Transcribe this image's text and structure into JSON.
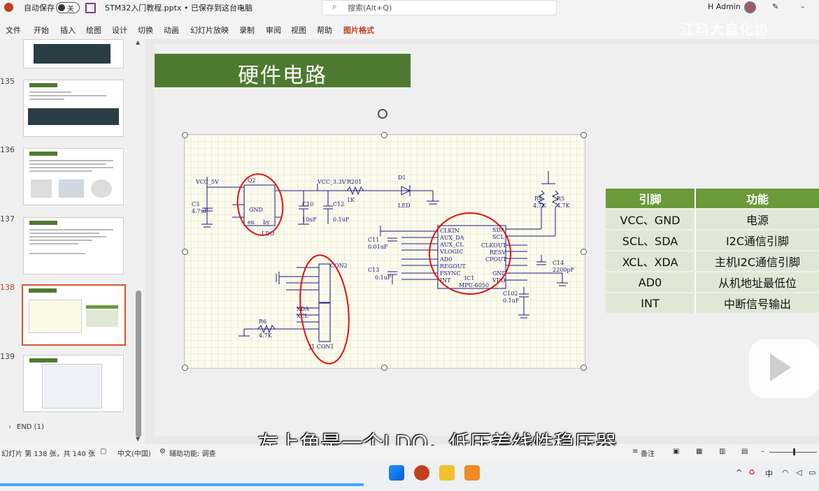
{
  "titlebar": {
    "autosave_label": "自动保存",
    "autosave_state": "关",
    "file_title": "STM32入门教程.pptx • 已保存到这台电脑",
    "search_placeholder": "搜索(Alt+Q)",
    "user": "H Admin",
    "minimize": "–"
  },
  "ribbon": {
    "tabs": [
      "文件",
      "开始",
      "插入",
      "绘图",
      "设计",
      "切换",
      "动画",
      "幻灯片放映",
      "录制",
      "审阅",
      "视图",
      "帮助",
      "图片格式"
    ],
    "active_tab": "图片格式"
  },
  "watermark": "江科大自化协",
  "thumbnails": [
    {
      "num": "135",
      "title": "I2C时序"
    },
    {
      "num": "136",
      "title": "MPU6050简介"
    },
    {
      "num": "137",
      "title": "MPU6050参数"
    },
    {
      "num": "138",
      "title": "硬件电路",
      "selected": true
    },
    {
      "num": "139",
      "title": "MPU6050框图"
    }
  ],
  "section_end": "END (1)",
  "slide": {
    "title": "硬件电路",
    "table": {
      "headers": [
        "引脚",
        "功能"
      ],
      "rows": [
        [
          "VCC、GND",
          "电源"
        ],
        [
          "SCL、SDA",
          "I2C通信引脚"
        ],
        [
          "XCL、XDA",
          "主机I2C通信引脚"
        ],
        [
          "AD0",
          "从机地址最低位"
        ],
        [
          "INT",
          "中断信号输出"
        ]
      ]
    },
    "schematic": {
      "labels": [
        "VCC_5V",
        "Q2",
        "GND",
        "en",
        "by",
        "LDO",
        "C3",
        "4.7uF",
        "VCC_3.3V",
        "C10",
        "10uF",
        "C12",
        "0.1uF",
        "R201",
        "1K",
        "D1",
        "LED",
        "R4",
        "4.7K",
        "R5",
        "4.7K",
        "CLKIN",
        "AUX_DA",
        "AUX_CL",
        "VLOGIC",
        "AD0",
        "REGOUT",
        "FSYNC",
        "INT",
        "SDA",
        "SCL",
        "CLKOUT",
        "RESV",
        "CPOUT",
        "GND",
        "VDD",
        "IC1",
        "MPU-6050",
        "C11",
        "0.01uF",
        "C13",
        "0.1uF",
        "C14",
        "2200pF",
        "C102",
        "0.1uF",
        "XDA",
        "XCL",
        "R6",
        "4.7K",
        "J1 CON1",
        "CON2"
      ]
    }
  },
  "subtitle": "左上角是一个LDO，低压差线性稳压器",
  "statusbar": {
    "slide_info": "幻灯片 第 138 张，共 140 张",
    "language": "中文(中国)",
    "accessibility": "辅助功能: 调查",
    "notes": "备注"
  },
  "tray": {
    "ime": "中"
  }
}
